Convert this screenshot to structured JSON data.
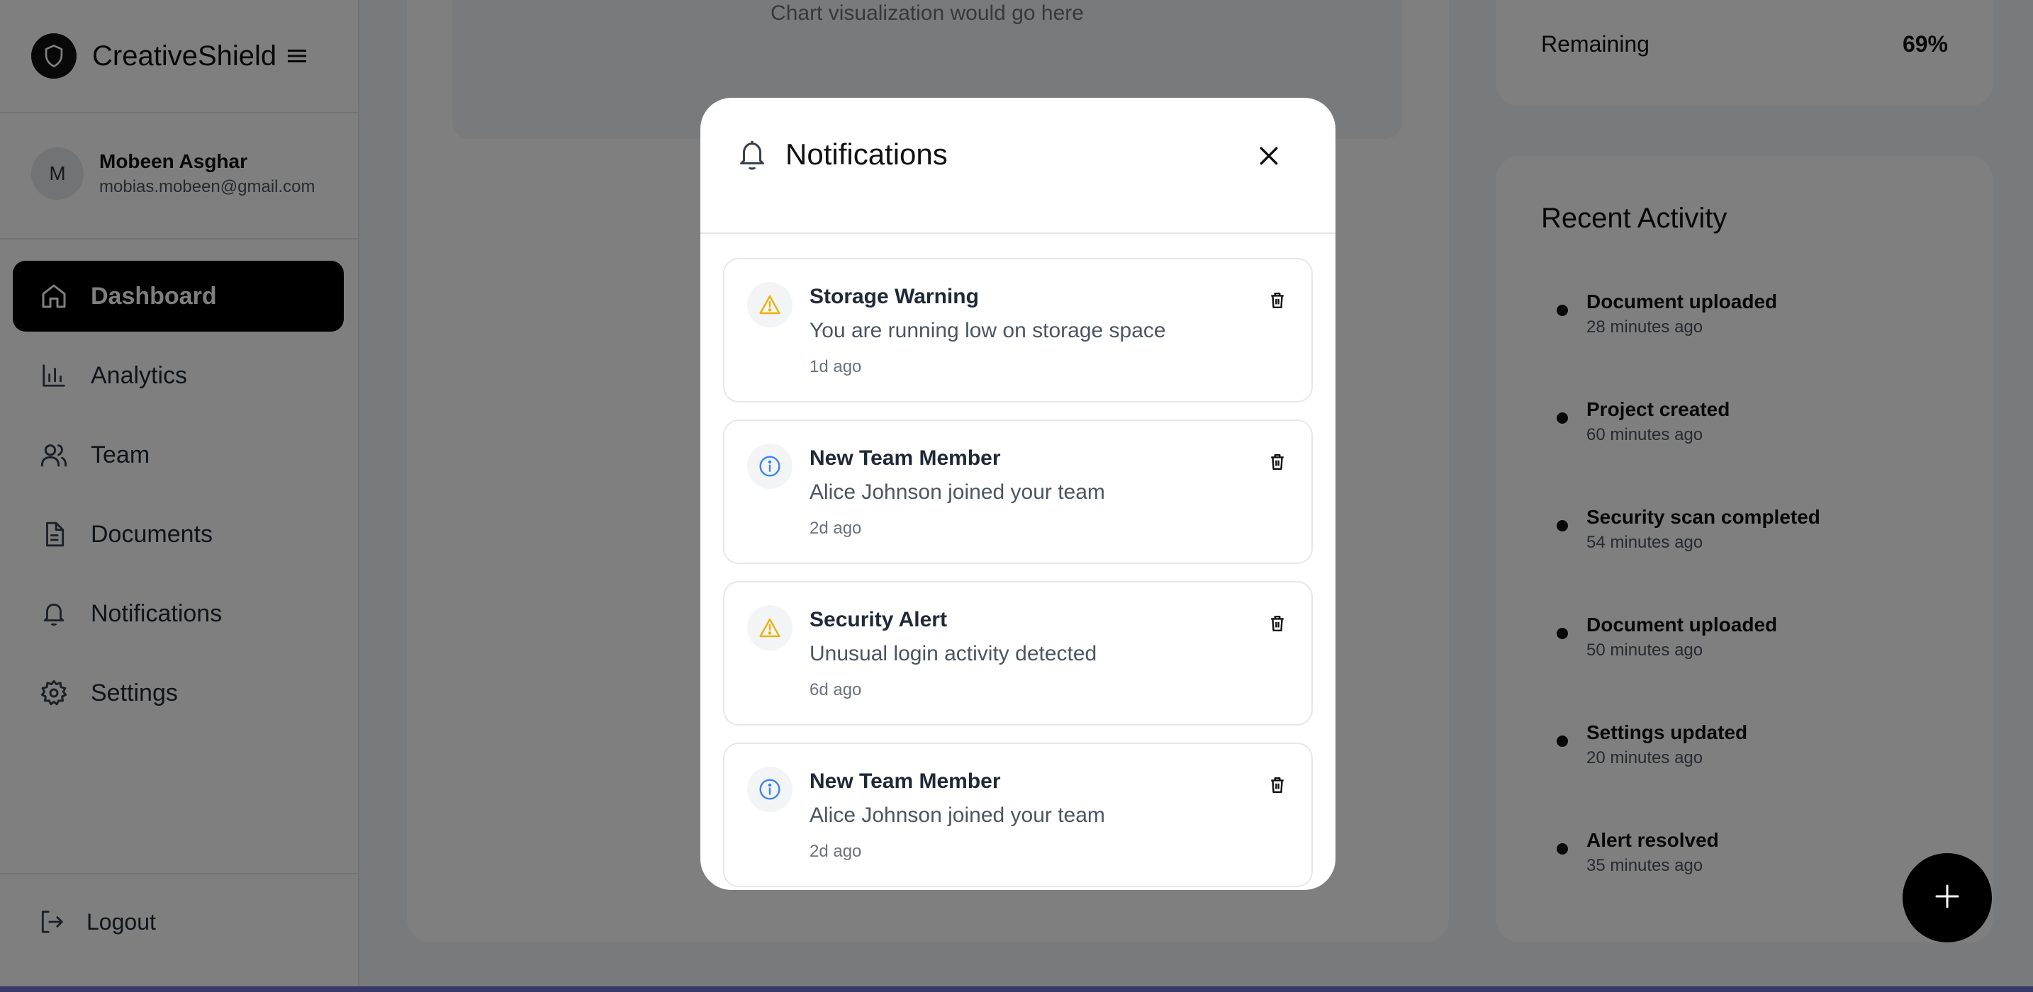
{
  "brand": {
    "name": "CreativeShield"
  },
  "user": {
    "initial": "M",
    "name": "Mobeen Asghar",
    "email": "mobias.mobeen@gmail.com"
  },
  "nav": [
    {
      "label": "Dashboard",
      "icon": "home-icon",
      "active": true
    },
    {
      "label": "Analytics",
      "icon": "bar-chart-icon"
    },
    {
      "label": "Team",
      "icon": "users-icon"
    },
    {
      "label": "Documents",
      "icon": "document-icon"
    },
    {
      "label": "Notifications",
      "icon": "bell-icon"
    },
    {
      "label": "Settings",
      "icon": "gear-icon"
    }
  ],
  "logout_label": "Logout",
  "main": {
    "chart_placeholder": "Chart visualization would go here",
    "storage": {
      "remaining_label": "Remaining",
      "remaining_value": "69%"
    },
    "activity": {
      "title": "Recent Activity",
      "items": [
        {
          "title": "Document uploaded",
          "time": "28 minutes ago"
        },
        {
          "title": "Project created",
          "time": "60 minutes ago"
        },
        {
          "title": "Security scan completed",
          "time": "54 minutes ago"
        },
        {
          "title": "Document uploaded",
          "time": "50 minutes ago"
        },
        {
          "title": "Settings updated",
          "time": "20 minutes ago"
        },
        {
          "title": "Alert resolved",
          "time": "35 minutes ago"
        }
      ]
    }
  },
  "modal": {
    "title": "Notifications",
    "notifications": [
      {
        "type": "warning",
        "title": "Storage Warning",
        "message": "You are running low on storage space",
        "time": "1d ago"
      },
      {
        "type": "info",
        "title": "New Team Member",
        "message": "Alice Johnson joined your team",
        "time": "2d ago"
      },
      {
        "type": "warning",
        "title": "Security Alert",
        "message": "Unusual login activity detected",
        "time": "6d ago"
      },
      {
        "type": "info",
        "title": "New Team Member",
        "message": "Alice Johnson joined your team",
        "time": "2d ago"
      }
    ]
  },
  "colors": {
    "warning": "#eab308",
    "info": "#3b82f6",
    "active_nav": "#000000",
    "overlay": "rgba(0,0,0,0.5)"
  }
}
